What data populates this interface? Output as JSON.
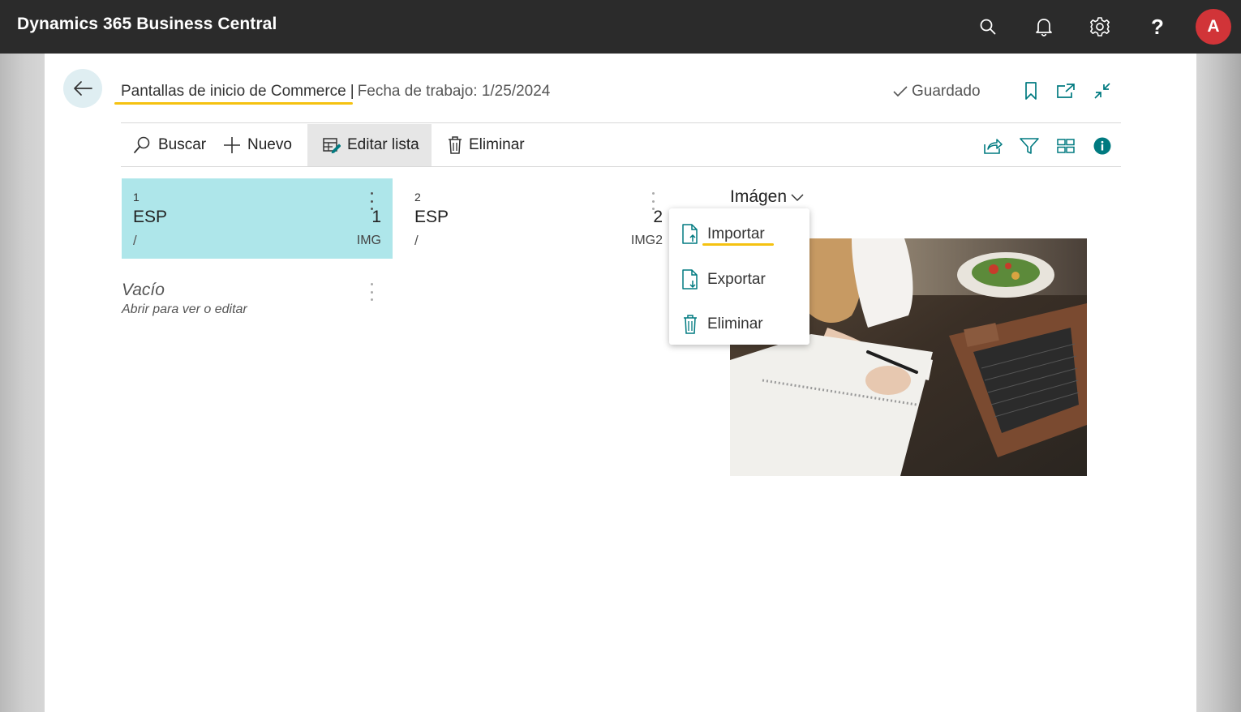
{
  "app": {
    "title": "Dynamics 365 Business Central",
    "avatar_initial": "A",
    "icons": [
      "search-icon",
      "bell-icon",
      "gear-icon",
      "help-icon"
    ]
  },
  "header": {
    "page_title": "Pantallas de inicio de Commerce",
    "separator": "|",
    "work_date": "Fecha de trabajo: 1/25/2024",
    "saved_label": "Guardado"
  },
  "actions": {
    "search": "Buscar",
    "new": "Nuevo",
    "edit_list": "Editar lista",
    "delete": "Eliminar"
  },
  "tiles": [
    {
      "number": "1",
      "code": "ESP",
      "value": "1",
      "slash": "/",
      "image": "IMG"
    },
    {
      "number": "2",
      "code": "ESP",
      "value": "2",
      "slash": "/",
      "image": "IMG2"
    }
  ],
  "empty_tile": {
    "title": "Vacío",
    "subtitle": "Abrir para ver o editar"
  },
  "image_field": {
    "label": "Imágen"
  },
  "context_menu": {
    "items": [
      {
        "label": "Importar",
        "icon": "import-file-icon"
      },
      {
        "label": "Exportar",
        "icon": "export-file-icon"
      },
      {
        "label": "Eliminar",
        "icon": "trash-icon"
      }
    ]
  },
  "colors": {
    "top_bar": "#2b2b2b",
    "accent": "#007a80",
    "tile_selected": "#aee6ea",
    "avatar": "#d13438",
    "highlight": "#f5c211"
  }
}
